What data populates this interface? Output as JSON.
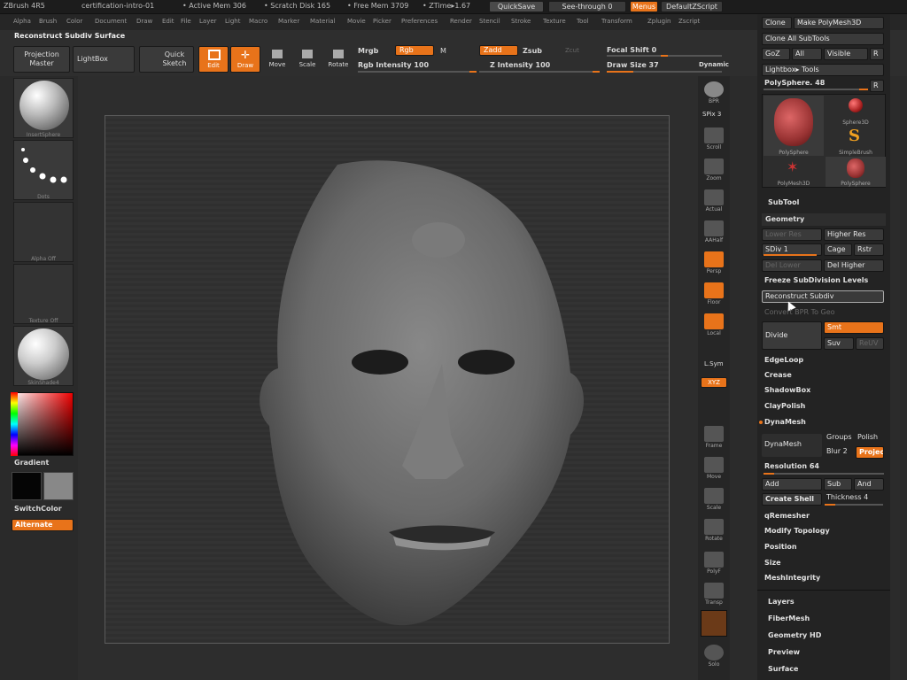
{
  "titlebar": {
    "app": "ZBrush 4R5",
    "doc": "certification-intro-01",
    "active_mem": "• Active Mem 306",
    "scratch": "• Scratch Disk 165",
    "free_mem": "• Free Mem 3709",
    "ztime": "• ZTime▸1.67",
    "quicksave": "QuickSave",
    "seethrough": "See-through",
    "seethrough_val": "0",
    "menus": "Menus",
    "defaultzscript": "DefaultZScript"
  },
  "menubar": [
    "Alpha",
    "Brush",
    "Color",
    "Document",
    "Draw",
    "Edit",
    "File",
    "Layer",
    "Light",
    "Macro",
    "Marker",
    "Material",
    "Movie",
    "Picker",
    "Preferences",
    "Render",
    "Stencil",
    "Stroke",
    "Texture",
    "Tool",
    "Transform",
    "Zplugin",
    "Zscript"
  ],
  "toolbar": {
    "status": "Reconstruct Subdiv Surface",
    "projection_master": "Projection Master",
    "lightbox": "LightBox",
    "quick_sketch": "Quick Sketch",
    "edit": "Edit",
    "draw": "Draw",
    "move": "Move",
    "scale": "Scale",
    "rotate": "Rotate",
    "mrgb": "Mrgb",
    "rgb": "Rgb",
    "m": "M",
    "rgb_intensity": "Rgb Intensity 100",
    "zadd": "Zadd",
    "zsub": "Zsub",
    "zcut": "Zcut",
    "z_intensity": "Z Intensity 100",
    "focal_shift": "Focal Shift 0",
    "draw_size": "Draw Size 37",
    "dynamic": "Dynamic"
  },
  "leftpanel": {
    "brush_label": "InsertSphere",
    "stroke_label": "Dots",
    "alpha_label": "Alpha Off",
    "texture_label": "Texture Off",
    "material_label": "SkinShade4",
    "gradient": "Gradient",
    "switchcolor": "SwitchColor",
    "alternate": "Alternate"
  },
  "righttools": {
    "bpr": "BPR",
    "spix": "SPix 3",
    "scroll": "Scroll",
    "zoom": "Zoom",
    "actual": "Actual",
    "aahalf": "AAHalf",
    "persp": "Persp",
    "floor": "Floor",
    "local": "Local",
    "lsym": "L.Sym",
    "xyz": "XYZ",
    "frame": "Frame",
    "move": "Move",
    "scale": "Scale",
    "rotate": "Rotate",
    "polyf": "PolyF",
    "transp": "Transp",
    "solo": "Solo"
  },
  "rightpanel": {
    "clone": "Clone",
    "make_polymesh": "Make PolyMesh3D",
    "clone_all": "Clone All SubTools",
    "goz": "GoZ",
    "all": "All",
    "visible": "Visible",
    "r": "R",
    "lightbox_tools": "Lightbox▸ Tools",
    "polysphere_slider": "PolySphere. 48",
    "tools": [
      "PolySphere",
      "Sphere3D",
      "SimpleBrush",
      "PolyMesh3D",
      "PolySphere"
    ],
    "subtool": "SubTool",
    "geometry": "Geometry",
    "lower_res": "Lower Res",
    "higher_res": "Higher Res",
    "sdiv": "SDiv 1",
    "cage": "Cage",
    "rstr": "Rstr",
    "del_lower": "Del Lower",
    "del_higher": "Del Higher",
    "freeze": "Freeze SubDivision Levels",
    "reconstruct": "Reconstruct Subdiv",
    "convert_bpr": "Convert BPR To Geo",
    "divide": "Divide",
    "smt": "Smt",
    "suv": "Suv",
    "reluv": "ReUV",
    "edgeloop": "EdgeLoop",
    "crease": "Crease",
    "shadowbox": "ShadowBox",
    "claypolish": "ClayPolish",
    "dynamesh_hdr": "DynaMesh",
    "dynamesh": "DynaMesh",
    "groups": "Groups",
    "polish": "Polish",
    "blur": "Blur 2",
    "project": "Project",
    "resolution": "Resolution 64",
    "add": "Add",
    "sub": "Sub",
    "and": "And",
    "create_shell": "Create Shell",
    "thickness": "Thickness 4",
    "qremesher": "qRemesher",
    "modify_topology": "Modify Topology",
    "position": "Position",
    "size": "Size",
    "meshintegrity": "MeshIntegrity",
    "layers": "Layers",
    "fibermesh": "FiberMesh",
    "geometry_hd": "Geometry HD",
    "preview": "Preview",
    "surface": "Surface"
  },
  "colors": {
    "accent": "#e8731a",
    "panel": "#232323",
    "button": "#3a3a3a"
  }
}
